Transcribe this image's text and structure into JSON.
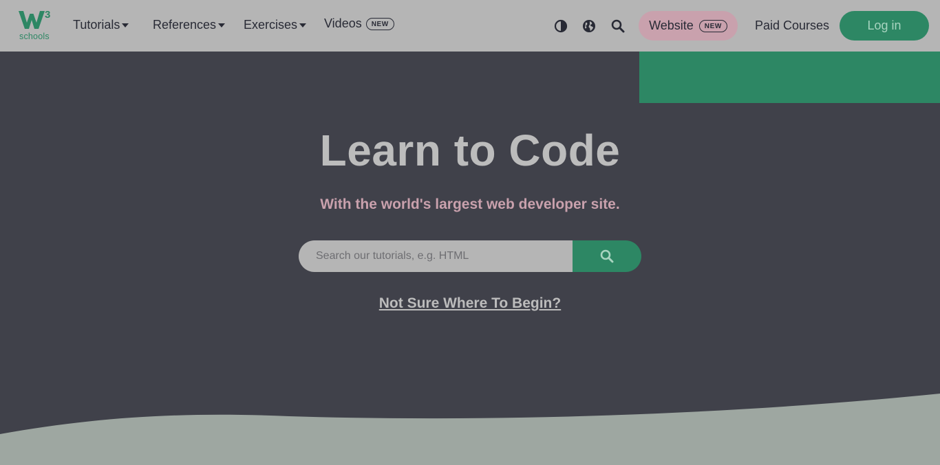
{
  "logo": {
    "superscript": "3",
    "text": "schools"
  },
  "nav": {
    "tutorials": "Tutorials",
    "references": "References",
    "exercises": "Exercises",
    "videos": "Videos",
    "new_badge": "NEW",
    "website": "Website",
    "paid_courses": "Paid Courses",
    "login": "Log in"
  },
  "icons": {
    "theme": "contrast-icon",
    "language": "globe-icon",
    "search": "search-icon"
  },
  "hero": {
    "title": "Learn to Code",
    "subtitle": "With the world's largest web developer site.",
    "search_placeholder": "Search our tutorials, e.g. HTML",
    "not_sure": "Not Sure Where To Begin?"
  },
  "colors": {
    "nav_bg": "#b5b5b5",
    "hero_bg": "#40414a",
    "accent_green": "#2d8764",
    "pink": "#c9a1ad",
    "wave": "#9ea7a1"
  }
}
